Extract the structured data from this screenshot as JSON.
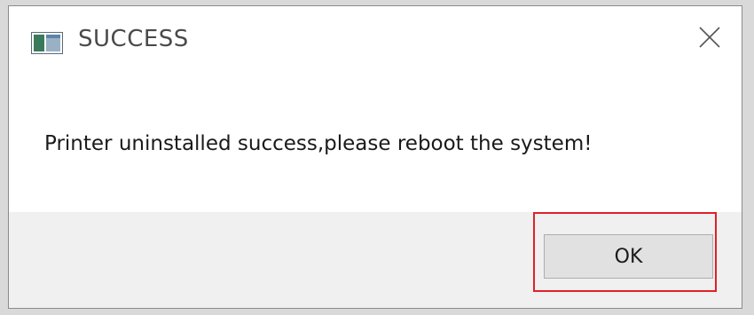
{
  "dialog": {
    "title": "SUCCESS",
    "message": "Printer uninstalled success,please reboot the system!",
    "ok_label": "OK",
    "close_icon": "close-icon",
    "app_icon": "window-app-icon"
  },
  "colors": {
    "highlight": "#e0202a",
    "footer_bg": "#f0f0f0",
    "button_bg": "#e1e1e1"
  }
}
